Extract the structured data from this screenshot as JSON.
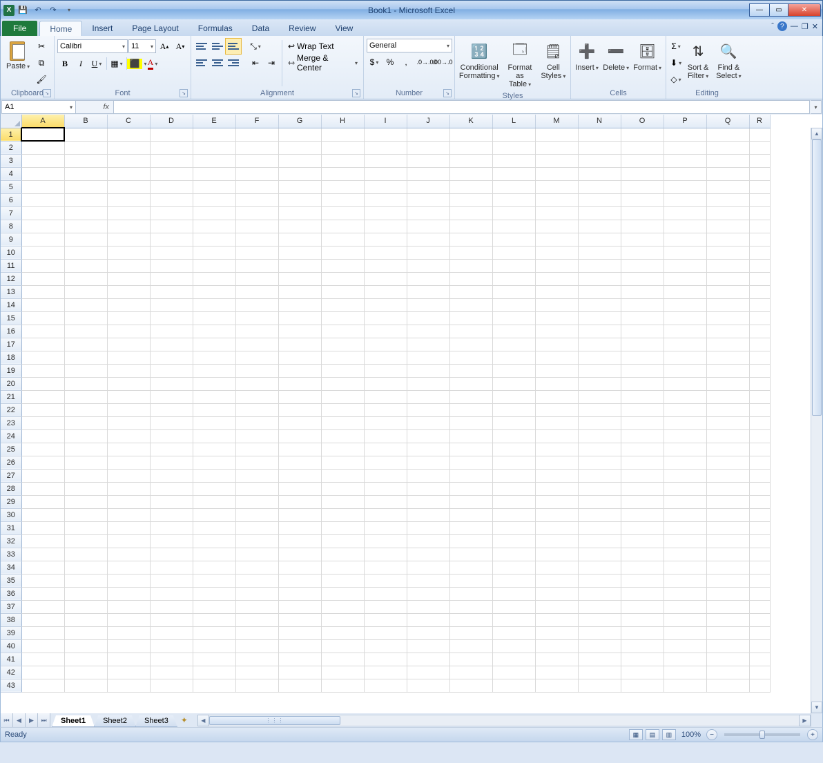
{
  "title": "Book1 - Microsoft Excel",
  "tabs": {
    "file": "File",
    "list": [
      "Home",
      "Insert",
      "Page Layout",
      "Formulas",
      "Data",
      "Review",
      "View"
    ],
    "active": "Home"
  },
  "namebox": "A1",
  "formula": "",
  "font": {
    "name": "Calibri",
    "size": "11"
  },
  "number_format": "General",
  "ribbon": {
    "clipboard": {
      "label": "Clipboard",
      "paste": "Paste"
    },
    "font": {
      "label": "Font"
    },
    "alignment": {
      "label": "Alignment",
      "wrap": "Wrap Text",
      "merge": "Merge & Center"
    },
    "number": {
      "label": "Number"
    },
    "styles": {
      "label": "Styles",
      "cond": "Conditional\nFormatting",
      "table": "Format\nas Table",
      "cell": "Cell\nStyles"
    },
    "cells": {
      "label": "Cells",
      "insert": "Insert",
      "delete": "Delete",
      "format": "Format"
    },
    "editing": {
      "label": "Editing",
      "sort": "Sort &\nFilter",
      "find": "Find &\nSelect"
    }
  },
  "columns": [
    "A",
    "B",
    "C",
    "D",
    "E",
    "F",
    "G",
    "H",
    "I",
    "J",
    "K",
    "L",
    "M",
    "N",
    "O",
    "P",
    "Q",
    "R"
  ],
  "active_col": "A",
  "rows": 43,
  "active_row": 1,
  "sheets": [
    "Sheet1",
    "Sheet2",
    "Sheet3"
  ],
  "active_sheet": "Sheet1",
  "status": "Ready",
  "zoom": "100%"
}
